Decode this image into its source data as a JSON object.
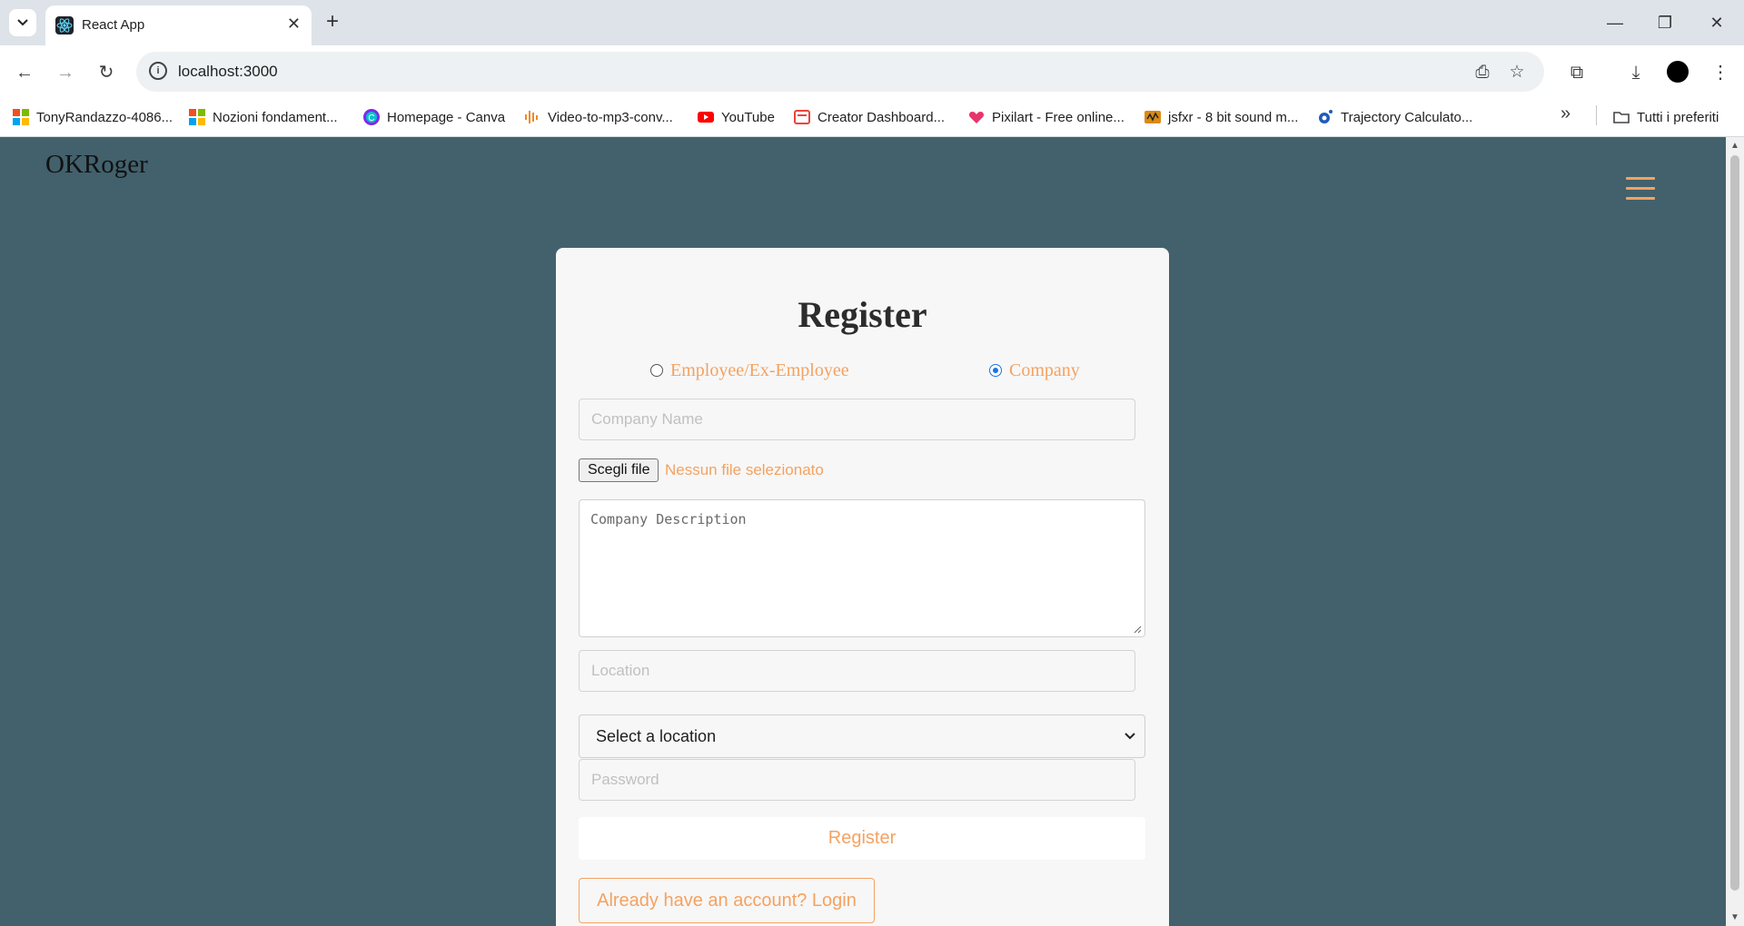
{
  "browser": {
    "tab_title": "React App",
    "url": "localhost:3000",
    "bookmarks": [
      {
        "label": "TonyRandazzo-4086...",
        "icon": "microsoft-icon"
      },
      {
        "label": "Nozioni fondament...",
        "icon": "microsoft-icon"
      },
      {
        "label": "Homepage - Canva",
        "icon": "canva-icon"
      },
      {
        "label": "Video-to-mp3-conv...",
        "icon": "audio-icon"
      },
      {
        "label": "YouTube",
        "icon": "youtube-icon"
      },
      {
        "label": "Creator Dashboard...",
        "icon": "dashboard-icon"
      },
      {
        "label": "Pixilart - Free online...",
        "icon": "heart-icon"
      },
      {
        "label": "jsfxr - 8 bit sound m...",
        "icon": "sound-icon"
      },
      {
        "label": "Trajectory Calculato...",
        "icon": "trajectory-icon"
      }
    ],
    "all_bookmarks_label": "Tutti i preferiti"
  },
  "app": {
    "brand": "OKRoger",
    "accent_color": "#f4a261",
    "background_color": "#42616c"
  },
  "form": {
    "title": "Register",
    "radio_employee": "Employee/Ex-Employee",
    "radio_company": "Company",
    "selected_role": "Company",
    "company_name_placeholder": "Company Name",
    "file_button_label": "Scegli file",
    "file_status": "Nessun file selezionato",
    "description_placeholder": "Company Description",
    "location_placeholder": "Location",
    "select_value": "Select a location",
    "password_placeholder": "Password",
    "register_button": "Register",
    "login_button": "Already have an account? Login"
  }
}
